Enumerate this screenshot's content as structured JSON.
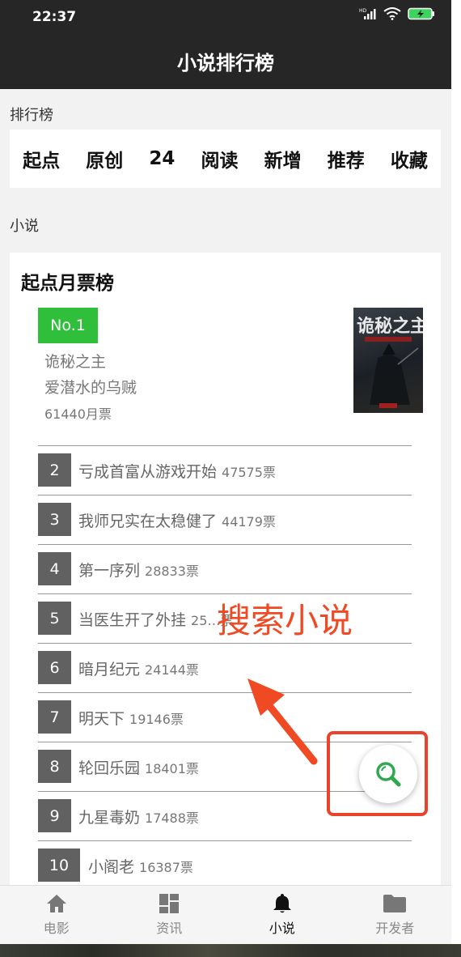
{
  "status_bar": {
    "time": "22:37"
  },
  "header": {
    "title": "小说排行榜"
  },
  "rank_section": {
    "label": "排行榜",
    "tabs": [
      "起点",
      "原创",
      "24",
      "阅读",
      "新增",
      "推荐",
      "收藏"
    ]
  },
  "novel_section": {
    "label": "小说"
  },
  "card": {
    "title": "起点月票榜",
    "top": {
      "badge": "No.1",
      "title": "诡秘之主",
      "author": "爱潜水的乌贼",
      "votes": "61440月票",
      "cover_text": "诡秘之主"
    },
    "list": [
      {
        "rank": "2",
        "name": "亏成首富从游戏开始",
        "votes": "47575票"
      },
      {
        "rank": "3",
        "name": "我师兄实在太稳健了",
        "votes": "44179票"
      },
      {
        "rank": "4",
        "name": "第一序列",
        "votes": "28833票"
      },
      {
        "rank": "5",
        "name": "当医生开了外挂",
        "votes": "25…票"
      },
      {
        "rank": "6",
        "name": "暗月纪元",
        "votes": "24144票"
      },
      {
        "rank": "7",
        "name": "明天下",
        "votes": "19146票"
      },
      {
        "rank": "8",
        "name": "轮回乐园",
        "votes": "18401票"
      },
      {
        "rank": "9",
        "name": "九星毒奶",
        "votes": "17488票"
      },
      {
        "rank": "10",
        "name": "小阁老",
        "votes": "16387票"
      }
    ]
  },
  "annotation": {
    "text": "搜索小说",
    "color": "#f04a24"
  },
  "fab": {
    "icon": "search-icon",
    "color": "#2fa84f"
  },
  "bottom_nav": [
    {
      "label": "电影",
      "icon": "home-icon"
    },
    {
      "label": "资讯",
      "icon": "dashboard-icon"
    },
    {
      "label": "小说",
      "icon": "bell-icon",
      "active": true
    },
    {
      "label": "开发者",
      "icon": "folder-icon"
    }
  ]
}
